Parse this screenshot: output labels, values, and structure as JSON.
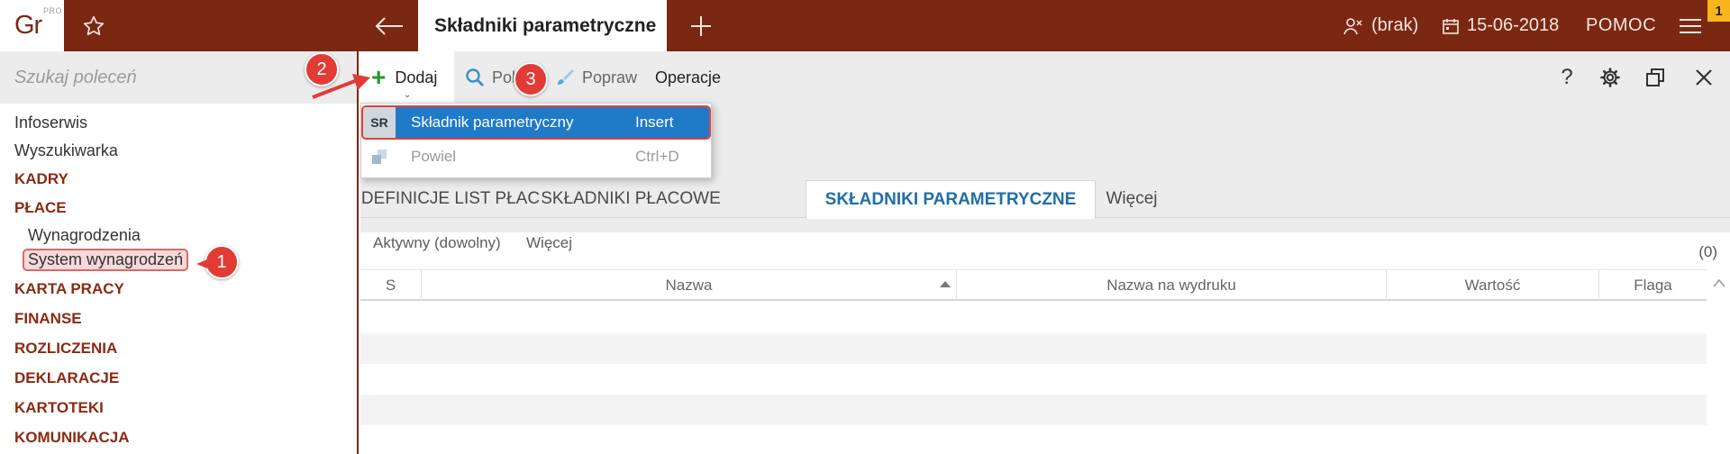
{
  "topbar": {
    "logo": "Gr",
    "logo_sup": "PRO",
    "active_tab_title": "Składniki parametryczne",
    "user_label": "(brak)",
    "date_label": "15-06-2018",
    "help_label": "POMOC",
    "notification_count": "1"
  },
  "sidebar": {
    "search_placeholder": "Szukaj poleceń",
    "items": [
      {
        "label": "Infoserwis"
      },
      {
        "label": "Wyszukiwarka"
      },
      {
        "label": "KADRY"
      },
      {
        "label": "PŁACE"
      },
      {
        "label": "Wynagrodzenia"
      },
      {
        "label": "System wynagrodzeń"
      },
      {
        "label": "KARTA PRACY"
      },
      {
        "label": "FINANSE"
      },
      {
        "label": "ROZLICZENIA"
      },
      {
        "label": "DEKLARACJE"
      },
      {
        "label": "KARTOTEKI"
      },
      {
        "label": "KOMUNIKACJA"
      }
    ]
  },
  "toolbar": {
    "dodaj_label": "Dodaj",
    "pokaz_label": "Pok",
    "popraw_label": "Popraw",
    "operacje_label": "Operacje",
    "help_icon_label": "?"
  },
  "dropdown": {
    "items": [
      {
        "icon": "SR",
        "label": "Składnik parametryczny",
        "shortcut": "Insert"
      },
      {
        "icon": "",
        "label": "Powiel",
        "shortcut": "Ctrl+D"
      }
    ]
  },
  "tabs": [
    {
      "label": "DEFINICJE LIST PŁAC"
    },
    {
      "label": "SKŁADNIKI PŁACOWE"
    },
    {
      "label": "SKŁADNIKI PARAMETRYCZNE"
    },
    {
      "label": "Więcej"
    }
  ],
  "filter": {
    "active_label": "Aktywny (dowolny)",
    "more_label": "Więcej",
    "count": "(0)"
  },
  "grid": {
    "columns": [
      {
        "label": "S"
      },
      {
        "label": "Nazwa"
      },
      {
        "label": "Nazwa na wydruku"
      },
      {
        "label": "Wartość"
      },
      {
        "label": "Flaga"
      }
    ]
  },
  "callouts": [
    "1",
    "2",
    "3"
  ],
  "colors": {
    "topbar": "#7b2812",
    "accent_tab": "#1f6fa8",
    "highlight": "#1f7ac8",
    "callout": "#e23b36",
    "plus": "#26962a"
  }
}
